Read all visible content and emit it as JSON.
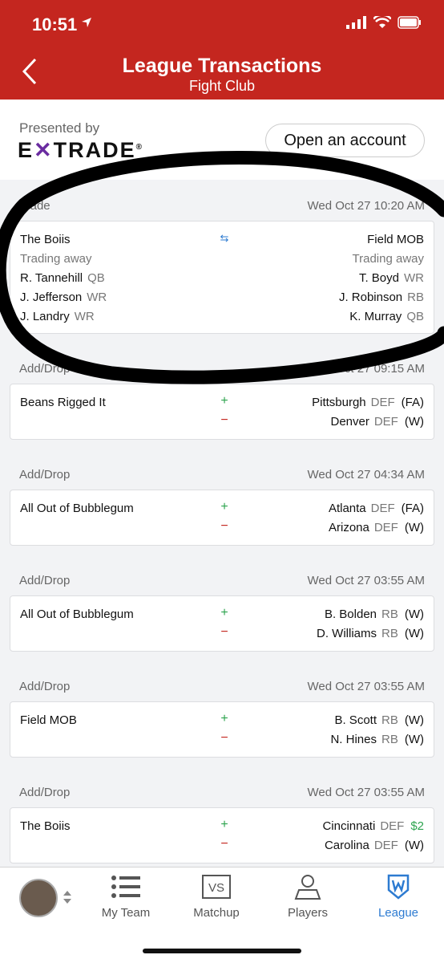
{
  "status": {
    "time": "10:51"
  },
  "header": {
    "title": "League Transactions",
    "subtitle": "Fight Club"
  },
  "sponsor": {
    "presented_label": "Presented by",
    "brand_before": "E",
    "brand_x": "✕",
    "brand_after": "TRADE",
    "brand_reg": "®",
    "button_label": "Open an account"
  },
  "trade": {
    "type": "Trade",
    "time": "Wed Oct 27 10:20 AM",
    "left_team": "The Boiis",
    "right_team": "Field MOB",
    "left_label": "Trading away",
    "right_label": "Trading away",
    "left_players": [
      {
        "name": "R. Tannehill",
        "pos": "QB"
      },
      {
        "name": "J. Jefferson",
        "pos": "WR"
      },
      {
        "name": "J. Landry",
        "pos": "WR"
      }
    ],
    "right_players": [
      {
        "name": "T. Boyd",
        "pos": "WR"
      },
      {
        "name": "J. Robinson",
        "pos": "RB"
      },
      {
        "name": "K. Murray",
        "pos": "QB"
      }
    ]
  },
  "adddrops": [
    {
      "type": "Add/Drop",
      "time": "Wed Oct 27 09:15 AM",
      "team": "Beans Rigged It",
      "add": {
        "name": "Pittsburgh",
        "pos": "DEF",
        "status": "(FA)"
      },
      "drop": {
        "name": "Denver",
        "pos": "DEF",
        "status": "(W)"
      }
    },
    {
      "type": "Add/Drop",
      "time": "Wed Oct 27 04:34 AM",
      "team": "All Out of Bubblegum",
      "add": {
        "name": "Atlanta",
        "pos": "DEF",
        "status": "(FA)"
      },
      "drop": {
        "name": "Arizona",
        "pos": "DEF",
        "status": "(W)"
      }
    },
    {
      "type": "Add/Drop",
      "time": "Wed Oct 27 03:55 AM",
      "team": "All Out of Bubblegum",
      "add": {
        "name": "B. Bolden",
        "pos": "RB",
        "status": "(W)"
      },
      "drop": {
        "name": "D. Williams",
        "pos": "RB",
        "status": "(W)"
      }
    },
    {
      "type": "Add/Drop",
      "time": "Wed Oct 27 03:55 AM",
      "team": "Field MOB",
      "add": {
        "name": "B. Scott",
        "pos": "RB",
        "status": "(W)"
      },
      "drop": {
        "name": "N. Hines",
        "pos": "RB",
        "status": "(W)"
      }
    },
    {
      "type": "Add/Drop",
      "time": "Wed Oct 27 03:55 AM",
      "team": "The Boiis",
      "add": {
        "name": "Cincinnati",
        "pos": "DEF",
        "status": "$2"
      },
      "drop": {
        "name": "Carolina",
        "pos": "DEF",
        "status": "(W)"
      }
    }
  ],
  "signs": {
    "plus": "+",
    "minus": "−",
    "swap": "⇆"
  },
  "tabs": [
    {
      "label": "My Team",
      "icon": "list-icon"
    },
    {
      "label": "Matchup",
      "icon": "vs-icon",
      "glyph": "VS"
    },
    {
      "label": "Players",
      "icon": "person-icon"
    },
    {
      "label": "League",
      "icon": "shield-icon",
      "active": true
    }
  ],
  "colors": {
    "header": "#c4261f",
    "active_tab": "#2d7bd1",
    "add": "#2ea44f",
    "drop": "#c4261f"
  }
}
